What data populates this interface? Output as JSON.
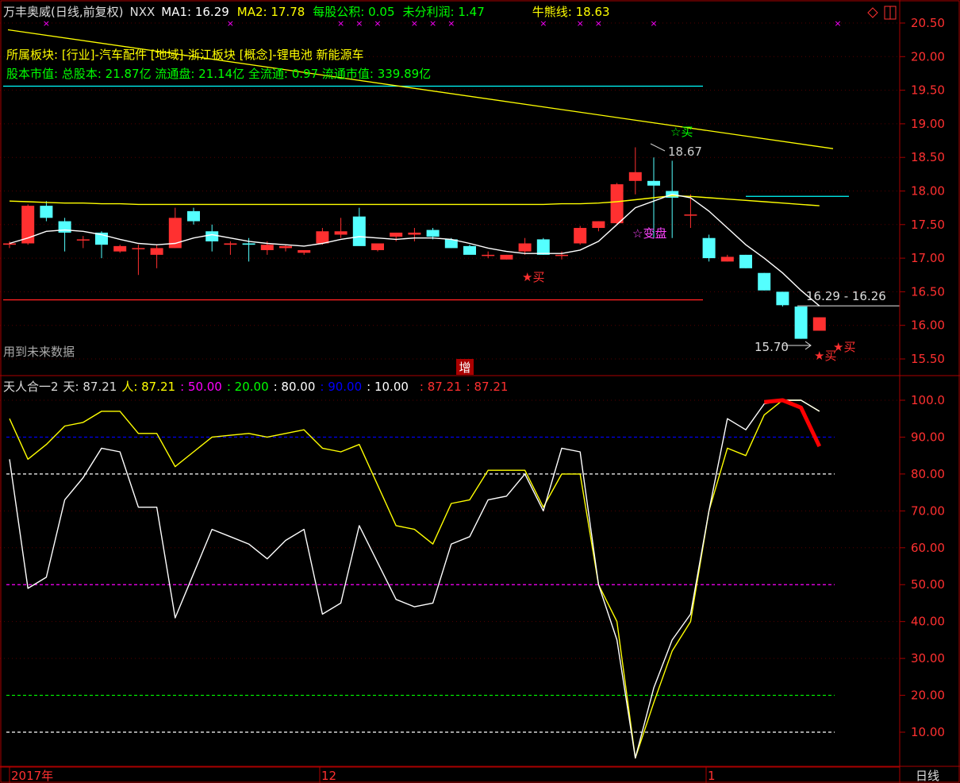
{
  "header": {
    "stock": "万丰奥威(日线,前复权)",
    "indicator": "NXX",
    "ma1": {
      "label": "MA1: 16.29",
      "color": "#ffffff"
    },
    "ma2": {
      "label": "MA2: 17.78",
      "color": "#ffff00"
    },
    "eps": {
      "label": "每股公积: 0.05",
      "color": "#00ff00"
    },
    "undist": {
      "label": "未分利润: 1.47",
      "color": "#00ff00"
    },
    "bull": {
      "label": "牛熊线: 18.63",
      "color": "#ffff00"
    }
  },
  "info": {
    "sector": "所属板块: [行业]-汽车配件 [地域]-浙江板块 [概念]-锂电池 新能源车",
    "capital": "股本市值: 总股本: 21.87亿 流通盘: 21.14亿 全流通: 0.97 流通市值: 339.89亿"
  },
  "future_note": "用到未来数据",
  "zeng_label": "增",
  "sub_header": {
    "name": "天人合一2",
    "tian": "天: 87.21",
    "ren": "人: 87.21",
    "levels": [
      {
        "text": ": 50.00",
        "color": "#ff00ff"
      },
      {
        "text": ": 20.00",
        "color": "#00ff00"
      },
      {
        "text": ": 80.00",
        "color": "#ffffff"
      },
      {
        "text": ": 90.00",
        "color": "#0000ff"
      },
      {
        "text": ": 10.00",
        "color": "#ffffff"
      },
      {
        "text": ": 87.21",
        "color": "#ff3030"
      },
      {
        "text": ": 87.21",
        "color": "#ff3030"
      }
    ]
  },
  "axis": {
    "main_ticks": [
      "20.50",
      "20.00",
      "19.50",
      "19.00",
      "18.50",
      "18.00",
      "17.50",
      "17.00",
      "16.50",
      "16.00",
      "15.50"
    ],
    "sub_ticks": [
      "100.0",
      "90.00",
      "80.00",
      "70.00",
      "60.00",
      "50.00",
      "40.00",
      "30.00",
      "20.00",
      "10.00"
    ],
    "x_labels": [
      "2017年",
      "12",
      "1"
    ],
    "period": "日线",
    "corner_icons": [
      "diamond-icon",
      "square-icon"
    ]
  },
  "annotations": {
    "buy": "买",
    "high_label": "18.67",
    "low_label": "15.70",
    "range_label": "16.29 - 16.26",
    "change_label": "变盘"
  },
  "colors": {
    "up": "#ff3030",
    "down": "#54ffff",
    "background": "#000000",
    "frame": "#aa0000"
  },
  "chart_data": [
    {
      "type": "candlestick",
      "ylim": [
        15.35,
        20.7
      ],
      "ohlc": [
        [
          17.2,
          17.25,
          17.15,
          17.22
        ],
        [
          17.22,
          17.8,
          17.2,
          17.78
        ],
        [
          17.78,
          17.85,
          17.55,
          17.6
        ],
        [
          17.55,
          17.6,
          17.1,
          17.38
        ],
        [
          17.28,
          17.33,
          17.15,
          17.28
        ],
        [
          17.38,
          17.4,
          17.0,
          17.2
        ],
        [
          17.1,
          17.2,
          17.08,
          17.18
        ],
        [
          17.15,
          17.2,
          16.75,
          17.15
        ],
        [
          17.05,
          17.2,
          16.85,
          17.15
        ],
        [
          17.15,
          17.75,
          17.15,
          17.6
        ],
        [
          17.7,
          17.75,
          17.5,
          17.55
        ],
        [
          17.4,
          17.5,
          17.1,
          17.25
        ],
        [
          17.2,
          17.25,
          17.05,
          17.22
        ],
        [
          17.22,
          17.3,
          16.95,
          17.2
        ],
        [
          17.12,
          17.25,
          17.05,
          17.2
        ],
        [
          17.15,
          17.2,
          17.1,
          17.18
        ],
        [
          17.08,
          17.1,
          17.05,
          17.12
        ],
        [
          17.22,
          17.45,
          17.2,
          17.4
        ],
        [
          17.35,
          17.6,
          17.3,
          17.4
        ],
        [
          17.62,
          17.75,
          17.2,
          17.18
        ],
        [
          17.12,
          17.22,
          17.1,
          17.22
        ],
        [
          17.32,
          17.38,
          17.25,
          17.38
        ],
        [
          17.35,
          17.45,
          17.25,
          17.38
        ],
        [
          17.42,
          17.45,
          17.28,
          17.32
        ],
        [
          17.28,
          17.3,
          17.15,
          17.15
        ],
        [
          17.18,
          17.2,
          17.08,
          17.05
        ],
        [
          17.05,
          17.1,
          17.0,
          17.05
        ],
        [
          16.98,
          17.05,
          16.98,
          17.05
        ],
        [
          17.1,
          17.3,
          17.05,
          17.22
        ],
        [
          17.28,
          17.3,
          17.05,
          17.05
        ],
        [
          17.05,
          17.1,
          16.98,
          17.05
        ],
        [
          17.22,
          17.48,
          17.2,
          17.45
        ],
        [
          17.45,
          17.55,
          17.4,
          17.55
        ],
        [
          17.52,
          18.12,
          17.5,
          18.1
        ],
        [
          18.15,
          18.65,
          17.95,
          18.28
        ],
        [
          18.15,
          18.5,
          17.3,
          18.08
        ],
        [
          18.0,
          18.45,
          17.3,
          17.9
        ],
        [
          17.65,
          17.95,
          17.45,
          17.65
        ],
        [
          17.3,
          17.35,
          16.95,
          17.0
        ],
        [
          16.95,
          17.05,
          16.95,
          17.02
        ],
        [
          17.05,
          17.05,
          16.85,
          16.85
        ],
        [
          16.78,
          16.78,
          16.52,
          16.52
        ],
        [
          16.5,
          16.5,
          16.28,
          16.3
        ],
        [
          16.28,
          16.28,
          15.8,
          15.8
        ],
        [
          15.92,
          16.12,
          15.92,
          16.12
        ]
      ],
      "ma1": [
        17.22,
        17.3,
        17.4,
        17.42,
        17.4,
        17.35,
        17.28,
        17.22,
        17.2,
        17.22,
        17.3,
        17.35,
        17.3,
        17.25,
        17.22,
        17.2,
        17.18,
        17.22,
        17.28,
        17.32,
        17.3,
        17.28,
        17.3,
        17.3,
        17.28,
        17.22,
        17.15,
        17.1,
        17.07,
        17.07,
        17.07,
        17.12,
        17.25,
        17.5,
        17.75,
        17.85,
        17.95,
        17.9,
        17.7,
        17.45,
        17.2,
        17.0,
        16.78,
        16.52,
        16.29
      ],
      "ma2": [
        17.85,
        17.84,
        17.83,
        17.82,
        17.82,
        17.81,
        17.81,
        17.8,
        17.8,
        17.8,
        17.8,
        17.8,
        17.8,
        17.8,
        17.8,
        17.8,
        17.8,
        17.8,
        17.8,
        17.8,
        17.8,
        17.8,
        17.8,
        17.8,
        17.8,
        17.8,
        17.8,
        17.8,
        17.8,
        17.8,
        17.81,
        17.81,
        17.82,
        17.84,
        17.87,
        17.9,
        17.93,
        17.92,
        17.9,
        17.88,
        17.86,
        17.84,
        17.82,
        17.8,
        17.78
      ],
      "bull_line": {
        "start": 20.4,
        "end": 18.63
      },
      "hlines": [
        {
          "value": 19.56,
          "color": "#00ffff"
        },
        {
          "value": 17.92,
          "color": "#00ffff"
        },
        {
          "value": 16.38,
          "color": "#ff2020"
        },
        {
          "value": 16.29,
          "color": "#aaaaaa"
        }
      ],
      "top_markers": [
        2,
        12,
        18,
        19,
        20,
        22,
        23,
        24,
        29,
        31,
        32,
        35,
        45
      ]
    },
    {
      "type": "line",
      "ylim": [
        0,
        105
      ],
      "levels": [
        {
          "value": 90,
          "color": "#0000ff"
        },
        {
          "value": 80,
          "color": "#ffffff"
        },
        {
          "value": 50,
          "color": "#ff00ff"
        },
        {
          "value": 20,
          "color": "#00ff00"
        },
        {
          "value": 10,
          "color": "#ffffff"
        }
      ],
      "grid": [
        30,
        40,
        60,
        70
      ],
      "series": [
        {
          "name": "天",
          "color": "#ffff00",
          "values": [
            95,
            84,
            88,
            93,
            94,
            97,
            97,
            91,
            91,
            82,
            86,
            90,
            90.5,
            91,
            90,
            91,
            92,
            87,
            86,
            88,
            77,
            66,
            65,
            61,
            72,
            73,
            81,
            81,
            81,
            71,
            80,
            80,
            50,
            40,
            3,
            18,
            32,
            40,
            70,
            87,
            85,
            96,
            100,
            100,
            97
          ]
        },
        {
          "name": "人",
          "color": "#ffffff",
          "values": [
            84,
            49,
            52,
            73,
            79,
            87,
            86,
            71,
            71,
            41,
            53,
            65,
            63,
            61,
            57,
            62,
            65,
            42,
            45,
            66,
            56,
            46,
            44,
            45,
            61,
            63,
            73,
            74,
            80,
            70,
            87,
            86,
            50,
            35,
            3,
            22,
            35,
            42,
            70,
            95,
            92,
            99,
            100,
            100,
            97
          ]
        },
        {
          "name": "",
          "color": "#ff0000",
          "values": [
            null,
            null,
            null,
            null,
            null,
            null,
            null,
            null,
            null,
            null,
            null,
            null,
            null,
            null,
            null,
            null,
            null,
            null,
            null,
            null,
            null,
            null,
            null,
            null,
            null,
            null,
            null,
            null,
            null,
            null,
            null,
            null,
            null,
            null,
            null,
            null,
            null,
            null,
            null,
            null,
            null,
            99.5,
            100,
            98,
            87.5
          ]
        }
      ]
    }
  ]
}
